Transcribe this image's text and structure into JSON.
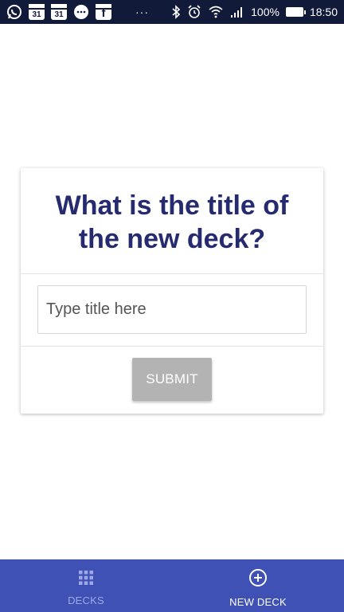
{
  "status_bar": {
    "cal_day_1": "31",
    "cal_day_2": "31",
    "fb_letter": "f",
    "overflow": "···",
    "battery": "100%",
    "time": "18:50",
    "icons_left": [
      "whatsapp-icon",
      "calendar-icon",
      "calendar-icon",
      "chat-icon",
      "facebook-icon",
      "more-icon"
    ],
    "icons_right": [
      "bluetooth-icon",
      "alarm-icon",
      "wifi-icon",
      "signal-icon",
      "battery-icon"
    ]
  },
  "card": {
    "title": "What is the title of the new deck?",
    "input_placeholder": "Type title here",
    "input_value": "",
    "submit_label": "SUBMIT"
  },
  "bottom_nav": {
    "items": [
      {
        "label": "DECKS",
        "icon": "grid-icon",
        "active": false
      },
      {
        "label": "NEW DECK",
        "icon": "add-circle-icon",
        "active": true
      }
    ]
  },
  "colors": {
    "status_bar": "#121a3a",
    "title": "#262b70",
    "nav_background": "#3f51b5",
    "nav_inactive": "#9fa8e6",
    "button_disabled": "#b3b3b3"
  }
}
